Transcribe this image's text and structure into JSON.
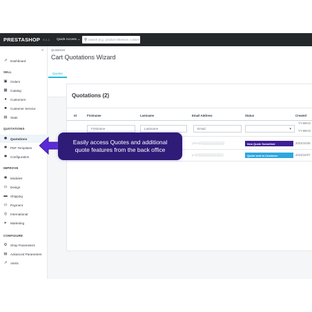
{
  "topbar": {
    "logo": "PRESTASHOP",
    "version": "8.1.1",
    "quick_access": "Quick Access ⌄",
    "search_placeholder": "Search (e.g.: product reference, custom"
  },
  "sidebar": {
    "collapse_icon": "«",
    "dashboard": "Dashboard",
    "sections": {
      "sell": "SELL",
      "quotations": "QUOTATIONS",
      "improve": "IMPROVE",
      "configure": "CONFIGURE"
    },
    "sell_items": [
      "Orders",
      "Catalog",
      "Customers",
      "Customer Service",
      "Stats"
    ],
    "quotation_items": [
      "Quotations",
      "PDF Templates",
      "Configuration"
    ],
    "improve_items": [
      "Modules",
      "Design",
      "Shipping",
      "Payment",
      "International",
      "Marketing"
    ],
    "configure_items": [
      "Shop Parameters",
      "Advanced Parameters",
      "Alerts"
    ]
  },
  "header": {
    "breadcrumb": "Quotations",
    "title": "Cart Quotations Wizard",
    "tab": "Quotes"
  },
  "quotations": {
    "title": "Quotations (2)",
    "columns": [
      "Id",
      "Firstname",
      "Lastname",
      "Email Address",
      "Status",
      "Created"
    ],
    "filters": {
      "firstname": "Firstname",
      "lastname": "Lastname",
      "email": "Email",
      "date_from": "YY-MM-D",
      "date_to": "YY-MM-D"
    },
    "rows": [
      {
        "email": "john@▒▒▒▒▒▒▒▒▒▒",
        "status": "New Quote Submitted",
        "status_color": "#3e1f94",
        "created": "2023/10/26"
      },
      {
        "email": "pr@▒▒▒▒▒▒▒▒▒▒▒",
        "status": "Quote sent to Customer",
        "status_color": "#2ea7e0",
        "created": "2023/10/27"
      }
    ]
  },
  "callout": {
    "line1": "Easily access  Quotes and additional",
    "line2": "quote features from the back office",
    "color": "#2f1b78",
    "arrow_color": "#5b2bd6"
  }
}
